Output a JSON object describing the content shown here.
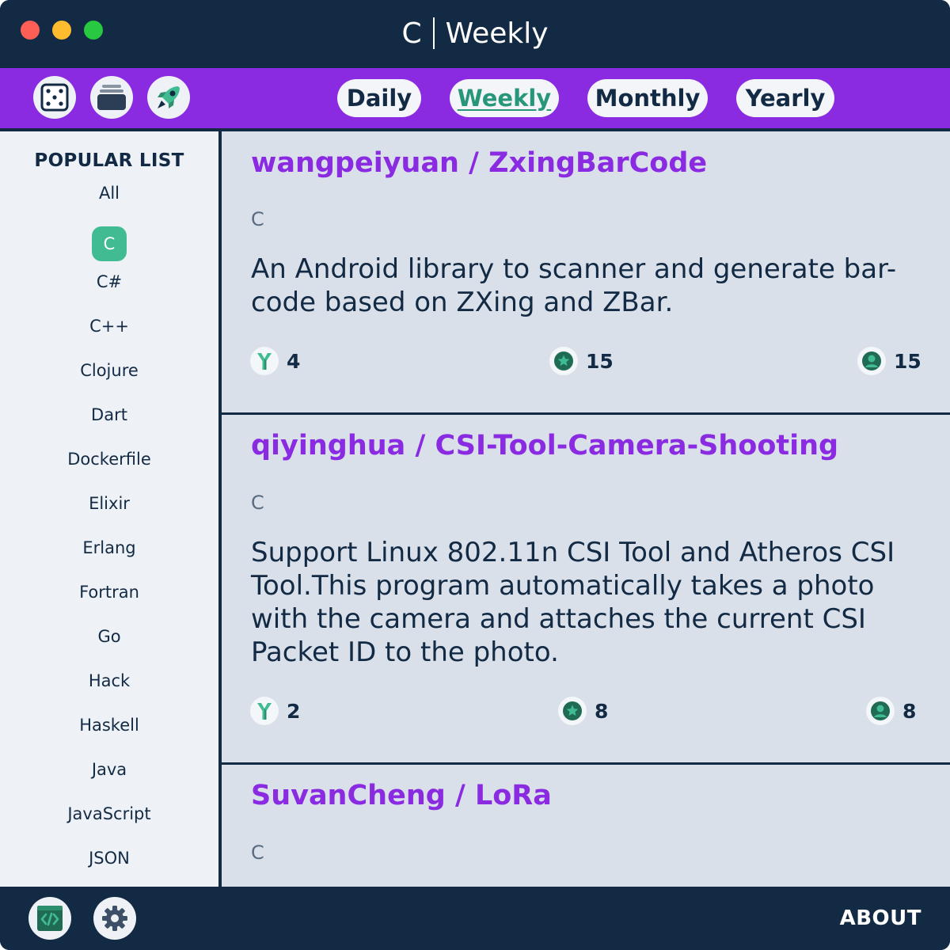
{
  "window": {
    "title_language": "C",
    "title_period": "Weekly"
  },
  "toolbar": {
    "icons": [
      "dice-icon",
      "archive-box-icon",
      "rocket-icon"
    ],
    "tabs": [
      {
        "label": "Daily"
      },
      {
        "label": "Weekly"
      },
      {
        "label": "Monthly"
      },
      {
        "label": "Yearly"
      }
    ],
    "active_tab": "Weekly"
  },
  "sidebar": {
    "heading": "POPULAR LIST",
    "languages": [
      "All",
      "C",
      "C#",
      "C++",
      "Clojure",
      "Dart",
      "Dockerfile",
      "Elixir",
      "Erlang",
      "Fortran",
      "Go",
      "Hack",
      "Haskell",
      "Java",
      "JavaScript",
      "JSON"
    ],
    "active_language": "C"
  },
  "repos": [
    {
      "title": "wangpeiyuan / ZxingBarCode",
      "language": "C",
      "description": "An Android library to scanner and generate bar-code based on ZXing and ZBar.",
      "forks": "4",
      "stars": "15",
      "watchers": "15"
    },
    {
      "title": "qiyinghua / CSI-Tool-Camera-Shooting",
      "language": "C",
      "description": "Support Linux 802.11n CSI Tool and Atheros CSI Tool.This program automatically takes a photo with the camera and attaches the current CSI Packet ID to the photo.",
      "forks": "2",
      "stars": "8",
      "watchers": "8"
    },
    {
      "title": "SuvanCheng / LoRa",
      "language": "C"
    }
  ],
  "footer": {
    "icons": [
      "code-icon",
      "gear-icon"
    ],
    "about_label": "ABOUT"
  },
  "colors": {
    "titlebar": "#132a44",
    "toolbar": "#8a2be2",
    "accent_green": "#41bc92",
    "active_tab_text": "#27967a",
    "repo_title": "#8a2be2",
    "content_bg": "#d9e0ea",
    "sidebar_bg": "#eef2f7"
  }
}
